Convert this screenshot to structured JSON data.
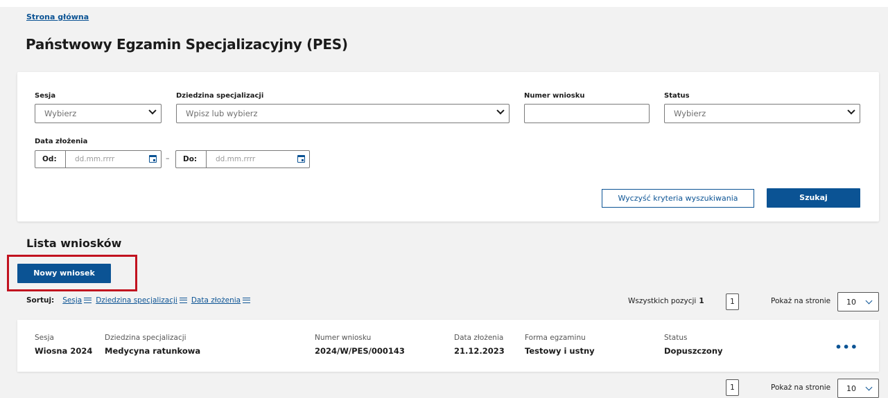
{
  "breadcrumb": "Strona główna",
  "page_title": "Państwowy Egzamin Specjalizacyjny (PES)",
  "filters": {
    "sesja_label": "Sesja",
    "sesja_value": "Wybierz",
    "dziedzina_label": "Dziedzina specjalizacji",
    "dziedzina_value": "Wpisz lub wybierz",
    "numer_label": "Numer wniosku",
    "numer_value": "",
    "status_label": "Status",
    "status_value": "Wybierz",
    "data_label": "Data złożenia",
    "od_label": "Od:",
    "od_placeholder": "dd.mm.rrrr",
    "do_label": "Do:",
    "do_placeholder": "dd.mm.rrrr",
    "range_sep": "–",
    "clear_label": "Wyczyść kryteria wyszukiwania",
    "search_label": "Szukaj"
  },
  "list": {
    "title": "Lista wniosków",
    "new_button": "Nowy wniosek",
    "sort_label": "Sortuj:",
    "sort_options": [
      "Sesja",
      "Dziedzina specjalizacji",
      "Data złożenia"
    ],
    "total_label": "Wszystkich pozycji",
    "total_count": "1",
    "page": "1",
    "per_page_label": "Pokaż na stronie",
    "per_page_value": "10"
  },
  "columns": [
    "Sesja",
    "Dziedzina specjalizacji",
    "Numer wniosku",
    "Data złożenia",
    "Forma egzaminu",
    "Status"
  ],
  "rows": [
    {
      "sesja": "Wiosna 2024",
      "dziedzina": "Medycyna ratunkowa",
      "numer": "2024/W/PES/000143",
      "data": "21.12.2023",
      "forma": "Testowy i ustny",
      "status": "Dopuszczony",
      "actions": "•••"
    }
  ],
  "colors": {
    "accent": "#0b5394",
    "highlight": "#c1121f",
    "background": "#f2f2f2"
  }
}
